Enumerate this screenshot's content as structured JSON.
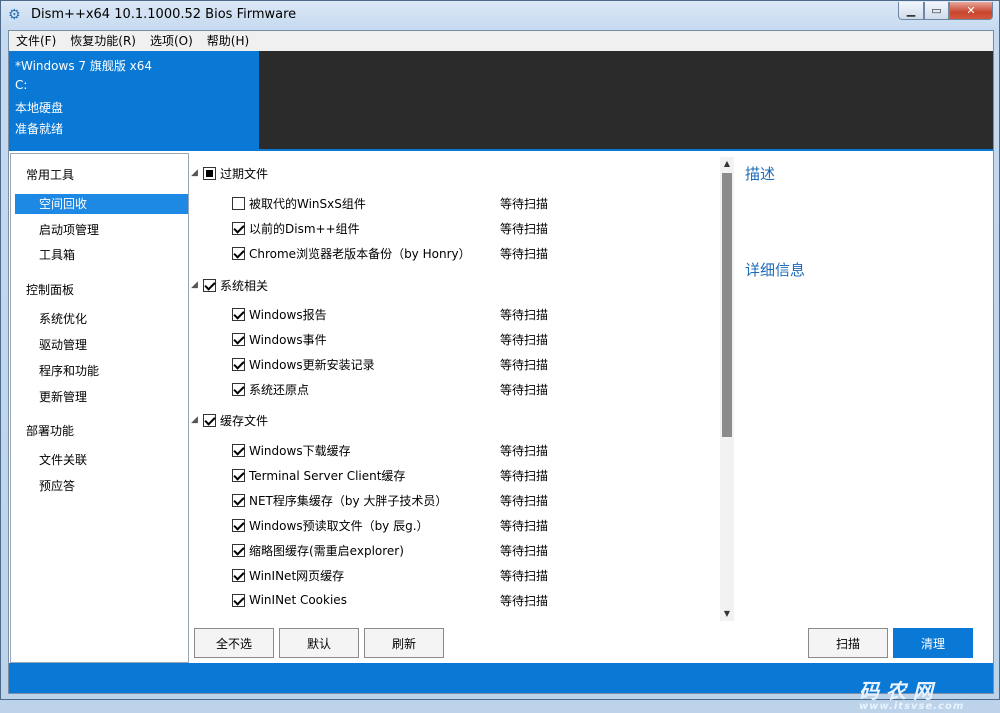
{
  "window": {
    "title": "Dism++x64 10.1.1000.52 Bios Firmware",
    "icon": "gears-icon"
  },
  "menu": [
    "文件(F)",
    "恢复功能(R)",
    "选项(O)",
    "帮助(H)"
  ],
  "info": {
    "os": "*Windows 7 旗舰版 x64",
    "drive": "C:",
    "disk_type": "本地硬盘",
    "status": "准备就绪"
  },
  "sidebar": {
    "groups": [
      {
        "label": "常用工具",
        "items": [
          "空间回收",
          "启动项管理",
          "工具箱"
        ]
      },
      {
        "label": "控制面板",
        "items": [
          "系统优化",
          "驱动管理",
          "程序和功能",
          "更新管理"
        ]
      },
      {
        "label": "部署功能",
        "items": [
          "文件关联",
          "预应答"
        ]
      }
    ],
    "selected": "空间回收"
  },
  "categories": [
    {
      "label": "过期文件",
      "state": "partial",
      "items": [
        {
          "label": "被取代的WinSxS组件",
          "checked": false,
          "status": "等待扫描"
        },
        {
          "label": "以前的Dism++组件",
          "checked": true,
          "status": "等待扫描"
        },
        {
          "label": "Chrome浏览器老版本备份（by Honry）",
          "checked": true,
          "status": "等待扫描"
        }
      ]
    },
    {
      "label": "系统相关",
      "state": "checked",
      "items": [
        {
          "label": "Windows报告",
          "checked": true,
          "status": "等待扫描"
        },
        {
          "label": "Windows事件",
          "checked": true,
          "status": "等待扫描"
        },
        {
          "label": "Windows更新安装记录",
          "checked": true,
          "status": "等待扫描"
        },
        {
          "label": "系统还原点",
          "checked": true,
          "status": "等待扫描"
        }
      ]
    },
    {
      "label": "缓存文件",
      "state": "checked",
      "items": [
        {
          "label": "Windows下载缓存",
          "checked": true,
          "status": "等待扫描"
        },
        {
          "label": "Terminal Server Client缓存",
          "checked": true,
          "status": "等待扫描"
        },
        {
          "label": "NET程序集缓存（by 大胖子技术员）",
          "checked": true,
          "status": "等待扫描"
        },
        {
          "label": "Windows预读取文件（by 辰g.）",
          "checked": true,
          "status": "等待扫描"
        },
        {
          "label": "缩略图缓存(需重启explorer)",
          "checked": true,
          "status": "等待扫描"
        },
        {
          "label": "WinINet网页缓存",
          "checked": true,
          "status": "等待扫描"
        },
        {
          "label": "WinINet Cookies",
          "checked": true,
          "status": "等待扫描"
        }
      ]
    }
  ],
  "right": {
    "desc_title": "描述",
    "detail_title": "详细信息"
  },
  "buttons": {
    "select_none": "全不选",
    "default": "默认",
    "refresh": "刷新",
    "scan": "扫描",
    "clean": "清理"
  },
  "watermark": {
    "line1": "码 农 网",
    "line2": "www.itsvse.com"
  },
  "colors": {
    "accent": "#0a79d6",
    "info_dark": "#2b2b2b",
    "heading_blue": "#1e6bb8"
  }
}
